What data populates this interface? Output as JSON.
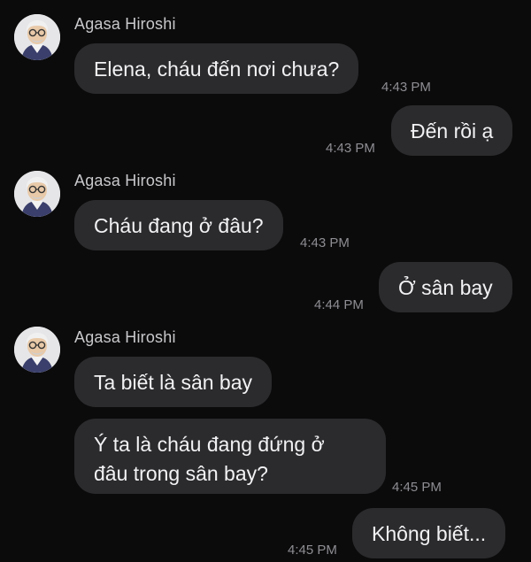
{
  "sender_name": "Agasa Hiroshi",
  "messages": [
    {
      "text": "Elena, cháu đến nơi chưa?",
      "time": "4:43 PM"
    },
    {
      "text": "Đến rồi ạ",
      "time": "4:43 PM"
    },
    {
      "text": "Cháu đang ở đâu?",
      "time": "4:43 PM"
    },
    {
      "text": "Ở sân bay",
      "time": "4:44 PM"
    },
    {
      "text": "Ta biết là sân bay"
    },
    {
      "text_line1": "Ý ta là cháu đang đứng ở",
      "text_line2": "đâu trong sân bay?",
      "time": "4:45 PM"
    },
    {
      "text": "Không biết...",
      "time": "4:45 PM"
    }
  ],
  "colors": {
    "background": "#0b0b0c",
    "bubble": "#2b2b2d",
    "text": "#f2f2f4",
    "timestamp": "#8e8e93"
  },
  "icons": {
    "avatar": "professor-avatar-icon"
  }
}
